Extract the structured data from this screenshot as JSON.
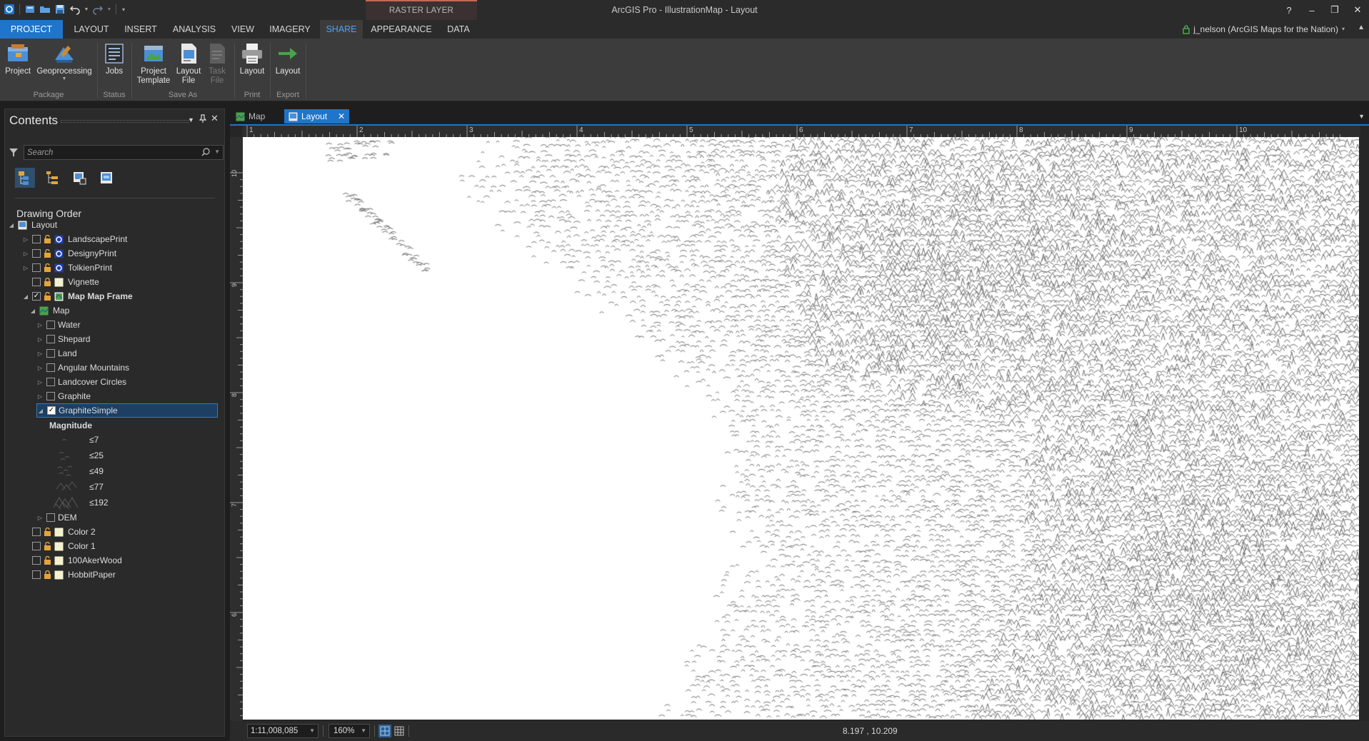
{
  "window": {
    "title": "ArcGIS Pro - IllustrationMap - Layout",
    "contextual_group": "RASTER LAYER",
    "help": "?",
    "minimize": "‒",
    "restore": "❐",
    "close": "✕"
  },
  "ribbon_tabs": {
    "project": "PROJECT",
    "layout": "LAYOUT",
    "insert": "INSERT",
    "analysis": "ANALYSIS",
    "view": "VIEW",
    "imagery": "IMAGERY",
    "share": "SHARE",
    "appearance": "APPEARANCE",
    "data": "DATA"
  },
  "user": {
    "signin": "j_nelson (ArcGIS Maps for the Nation)"
  },
  "ribbon": {
    "project": "Project",
    "geoprocessing": "Geoprocessing",
    "jobs": "Jobs",
    "project_template": [
      "Project",
      "Template"
    ],
    "layout_file": [
      "Layout",
      "File"
    ],
    "task_file": [
      "Task",
      "File"
    ],
    "print_layout": "Layout",
    "export_layout": "Layout",
    "groups": {
      "package": "Package",
      "status": "Status",
      "save_as": "Save As",
      "print": "Print",
      "export": "Export"
    }
  },
  "contents": {
    "title": "Contents",
    "search_placeholder": "Search",
    "section": "Drawing Order",
    "root": "Layout",
    "items": {
      "landscape_print": "LandscapePrint",
      "designy_print": "DesignyPrint",
      "tolkien_print": "TolkienPrint",
      "vignette": "Vignette",
      "map_frame": "Map Map Frame",
      "map": "Map",
      "water": "Water",
      "shepard": "Shepard",
      "land": "Land",
      "angular_mountains": "Angular Mountains",
      "landcover_circles": "Landcover Circles",
      "graphite": "Graphite",
      "graphite_simple": "GraphiteSimple",
      "dem": "DEM",
      "color2": "Color 2",
      "color1": "Color 1",
      "aker_wood": "100AkerWood",
      "hobbit_paper": "HobbitPaper"
    },
    "legend": {
      "heading": "Magnitude",
      "classes": [
        "≤7",
        "≤25",
        "≤49",
        "≤77",
        "≤192"
      ]
    },
    "checked": {
      "map_frame": true,
      "graphite_simple": true
    },
    "selected_item": "graphite_simple"
  },
  "doc_tabs": {
    "map": "Map",
    "layout": "Layout"
  },
  "ruler": {
    "top_labels": [
      "1",
      "2",
      "3",
      "4",
      "5",
      "6",
      "7",
      "8",
      "9",
      "10"
    ],
    "left_labels": [
      "10",
      "9",
      "8",
      "7",
      "6"
    ]
  },
  "statusbar": {
    "scale": "1:11,008,085",
    "zoom": "160%",
    "coords": "8.197 , 10.209"
  },
  "colors": {
    "accent": "#1f75c9",
    "accent_text": "#4aa3ff",
    "hatch": "#6e6e6e",
    "page": "#ffffff"
  }
}
